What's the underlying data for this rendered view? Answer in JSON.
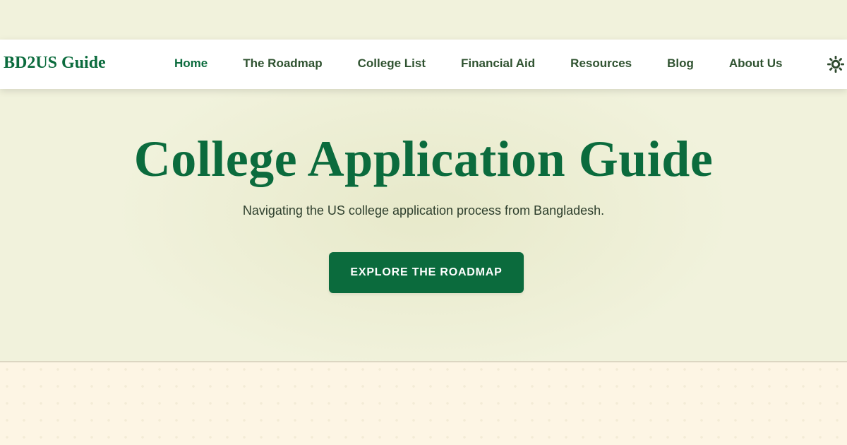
{
  "brand": {
    "name": "BD2US Guide"
  },
  "nav": {
    "items": [
      {
        "label": "Home",
        "active": true
      },
      {
        "label": "The Roadmap",
        "active": false
      },
      {
        "label": "College List",
        "active": false
      },
      {
        "label": "Financial Aid",
        "active": false
      },
      {
        "label": "Resources",
        "active": false
      },
      {
        "label": "Blog",
        "active": false
      },
      {
        "label": "About Us",
        "active": false
      }
    ],
    "theme_toggle_icon": "sun-icon"
  },
  "hero": {
    "title": "College Application Guide",
    "subtitle": "Navigating the US college application process from Bangladesh.",
    "cta_label": "EXPLORE THE ROADMAP"
  },
  "colors": {
    "brand_green": "#0b6b3d",
    "hero_background": "#f1f2dc",
    "lower_background": "#fdf5e4",
    "nav_text": "#2f5230"
  }
}
